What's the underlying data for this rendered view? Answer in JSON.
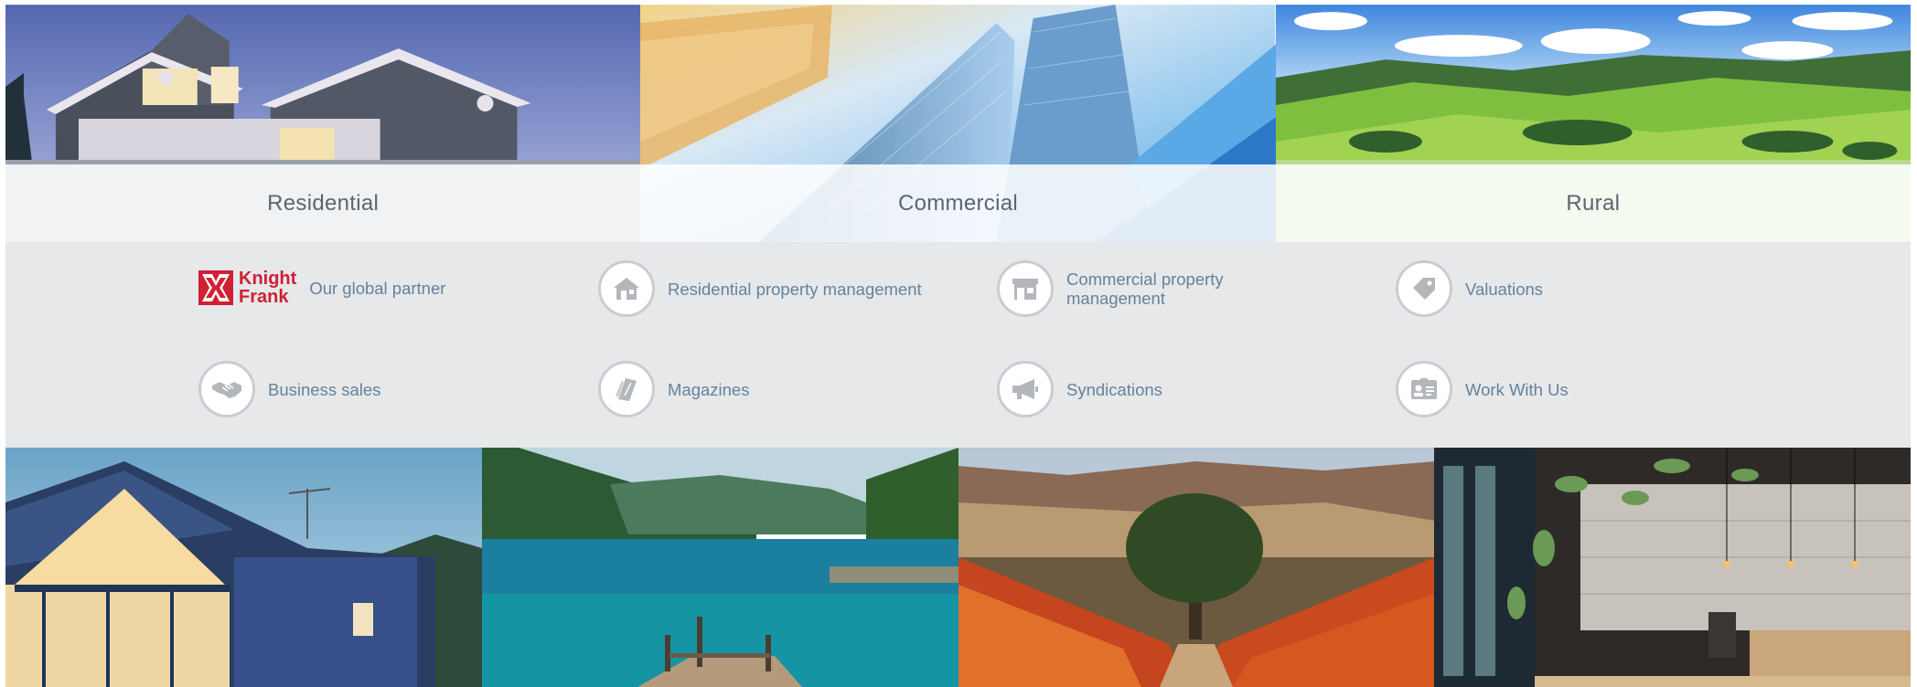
{
  "categories": [
    {
      "label": "Residential"
    },
    {
      "label": "Commercial"
    },
    {
      "label": "Rural"
    }
  ],
  "partner": {
    "logo_text_line1": "Knight",
    "logo_text_line2": "Frank",
    "label": "Our global partner"
  },
  "services": [
    {
      "label": "Residential property management",
      "icon": "house-icon"
    },
    {
      "label": "Commercial property management",
      "icon": "storefront-icon"
    },
    {
      "label": "Valuations",
      "icon": "price-tag-icon"
    },
    {
      "label": "Business sales",
      "icon": "handshake-icon"
    },
    {
      "label": "Magazines",
      "icon": "magazine-icon"
    },
    {
      "label": "Syndications",
      "icon": "megaphone-icon"
    },
    {
      "label": "Work With Us",
      "icon": "id-card-icon"
    }
  ],
  "colors": {
    "brand_red": "#d02034",
    "link_text": "#66829b",
    "band_bg": "#e6e8ea",
    "category_text": "#5b6670"
  },
  "photos": [
    {
      "name": "modern-house-photo"
    },
    {
      "name": "lake-jetty-photo"
    },
    {
      "name": "vineyard-photo"
    },
    {
      "name": "cafe-interior-photo"
    }
  ]
}
